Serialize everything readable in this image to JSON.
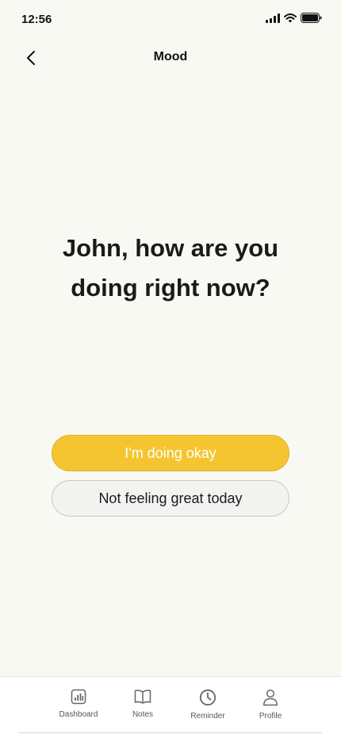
{
  "status_bar": {
    "time": "12:56",
    "icons": [
      "signal-icon",
      "wifi-icon",
      "battery-icon"
    ]
  },
  "header": {
    "title": "Mood",
    "back_icon": "chevron-left-icon"
  },
  "question": {
    "line1": "John, how are you",
    "line2": "doing right now?"
  },
  "choices": {
    "okay_label": "I'm doing okay",
    "not_great_label": "Not feeling great today"
  },
  "tab_bar": {
    "items": [
      {
        "label": "Dashboard",
        "icon": "chart-icon"
      },
      {
        "label": "Notes",
        "icon": "book-icon"
      },
      {
        "label": "Reminder",
        "icon": "clock-icon"
      },
      {
        "label": "Profile",
        "icon": "person-icon"
      }
    ]
  },
  "colors": {
    "background": "#f9f9f4",
    "accent": "#f5c531",
    "secondary_button": "#f3f3f1"
  }
}
